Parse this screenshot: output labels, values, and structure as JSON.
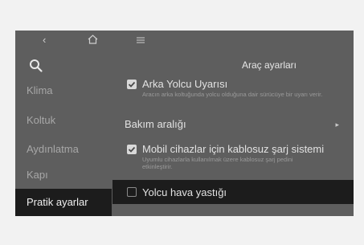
{
  "topbar": {
    "back_icon": "chevron-left-icon",
    "home_icon": "home-icon",
    "menu_icon": "menu-icon"
  },
  "sidebar": {
    "search_icon": "search-icon",
    "items": [
      {
        "label": "Klima"
      },
      {
        "label": "Koltuk"
      },
      {
        "label": "Aydınlatma"
      },
      {
        "label": "Kapı"
      },
      {
        "label": "Pratik ayarlar"
      }
    ]
  },
  "main": {
    "title": "Araç ayarları",
    "rows": [
      {
        "label": "Arka Yolcu Uyarısı",
        "description": "Aracın arka koltuğunda yolcu olduğuna dair sürücüye bir uyarı verir.",
        "checked": true
      },
      {
        "label": "Bakım aralığı",
        "chevron": "chevron-right-icon"
      },
      {
        "label": "Mobil cihazlar için kablosuz şarj sistemi",
        "description": "Uyumlu cihazlarla kullanılmak üzere kablosuz şarj pedini etkinleştirir.",
        "checked": true
      },
      {
        "label": "Yolcu hava yastığı",
        "checked": false
      }
    ]
  }
}
